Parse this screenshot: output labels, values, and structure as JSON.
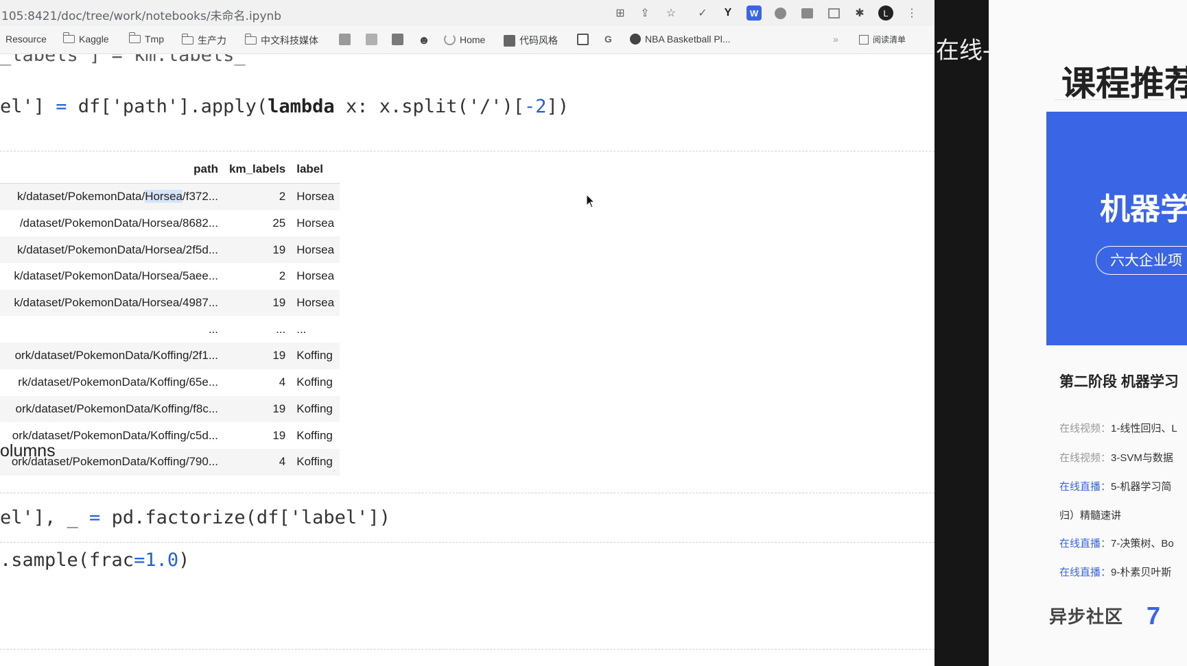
{
  "browser": {
    "url": "105:8421/doc/tree/work/notebooks/未命名.ipynb",
    "extension_icons": [
      "translate-icon",
      "share-icon",
      "star-icon",
      "check-icon",
      "y-ext-icon",
      "w-ext-icon",
      "circle-ext-icon",
      "box-ext-icon",
      "screen-ext-icon",
      "puzzle-icon",
      "profile-avatar",
      "menu-dots-icon"
    ],
    "avatar_letter": "L",
    "bookmarks": [
      {
        "label": "Resource",
        "icon": "none"
      },
      {
        "label": "Kaggle",
        "icon": "folder-icon"
      },
      {
        "label": "Tmp",
        "icon": "folder-icon"
      },
      {
        "label": "生产力",
        "icon": "folder-icon"
      },
      {
        "label": "中文科技媒体",
        "icon": "folder-icon"
      },
      {
        "label": "",
        "icon": "favicon"
      },
      {
        "label": "",
        "icon": "favicon"
      },
      {
        "label": "",
        "icon": "favicon"
      },
      {
        "label": "",
        "icon": "reddit-icon"
      },
      {
        "label": "Home",
        "icon": "loading-icon"
      },
      {
        "label": "代码风格",
        "icon": "favicon"
      },
      {
        "label": "",
        "icon": "favicon"
      },
      {
        "label": "",
        "icon": "google-icon"
      },
      {
        "label": "NBA Basketball Pl...",
        "icon": "globe-icon"
      }
    ],
    "reading_list": "阅读清单"
  },
  "notebook": {
    "line_top": "_labels'] = km.labels_",
    "line1_a": "el'] ",
    "line1_op": "=",
    "line1_b": " df['path'].apply(",
    "line1_kw": "lambda",
    "line1_c": " x: x.split('/')[",
    "line1_num": "-2",
    "line1_d": "])",
    "table": {
      "headers": [
        "path",
        "km_labels",
        "label"
      ],
      "rows": [
        [
          "k/dataset/PokemonData/Horsea/f372...",
          "2",
          "Horsea"
        ],
        [
          "/dataset/PokemonData/Horsea/8682...",
          "25",
          "Horsea"
        ],
        [
          "k/dataset/PokemonData/Horsea/2f5d...",
          "19",
          "Horsea"
        ],
        [
          "k/dataset/PokemonData/Horsea/5aee...",
          "2",
          "Horsea"
        ],
        [
          "k/dataset/PokemonData/Horsea/4987...",
          "19",
          "Horsea"
        ],
        [
          "...",
          "...",
          "..."
        ],
        [
          "ork/dataset/PokemonData/Koffing/2f1...",
          "19",
          "Koffing"
        ],
        [
          "rk/dataset/PokemonData/Koffing/65e...",
          "4",
          "Koffing"
        ],
        [
          "ork/dataset/PokemonData/Koffing/f8c...",
          "19",
          "Koffing"
        ],
        [
          "ork/dataset/PokemonData/Koffing/c5d...",
          "19",
          "Koffing"
        ],
        [
          "ork/dataset/PokemonData/Koffing/790...",
          "4",
          "Koffing"
        ]
      ],
      "highlight_word": "Horsea"
    },
    "heading": "olumns",
    "line2_a": "el'], _ ",
    "line2_op": "=",
    "line2_b": " pd.factorize(df['label'])",
    "line3_a": ".sample(frac",
    "line3_op": "=",
    "line3_num": "1.0",
    "line3_b": ")"
  },
  "dark_panel_text": "在线-j",
  "promo": {
    "title": "课程推荐",
    "banner_title": "机器学",
    "banner_button": "六大企业项",
    "stage": "第二阶段 机器学习",
    "courses": [
      {
        "tag": "在线视频：",
        "tag_color": "gray",
        "text": "1-线性回归、L"
      },
      {
        "tag": "在线视频：",
        "tag_color": "gray",
        "text": "3-SVM与数据"
      },
      {
        "tag": "在线直播：",
        "tag_color": "blue",
        "text": "5-机器学习简"
      },
      {
        "tag": "",
        "tag_color": "none",
        "text": "归）精髓速讲"
      },
      {
        "tag": "在线直播：",
        "tag_color": "blue",
        "text": "7-决策树、Bo"
      },
      {
        "tag": "在线直播：",
        "tag_color": "blue",
        "text": "9-朴素贝叶斯"
      }
    ],
    "logo_text": "异步社区",
    "logo2": "7"
  },
  "colors": {
    "accent": "#3a66e6",
    "operator": "#2060d8",
    "dark": "#161616"
  }
}
